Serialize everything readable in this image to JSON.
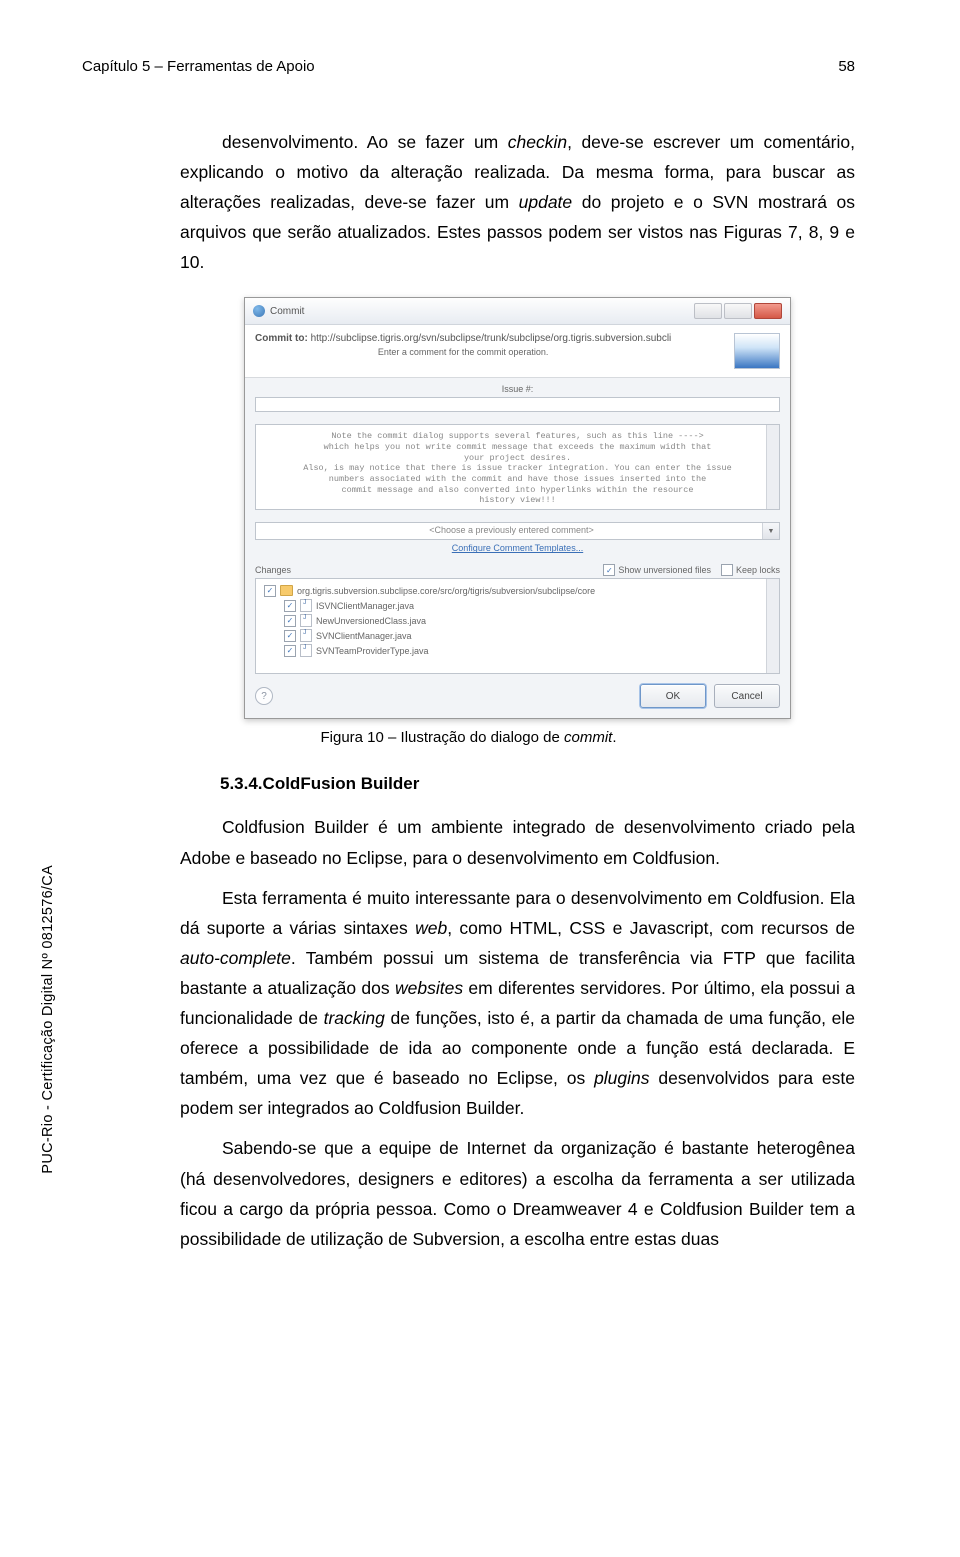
{
  "header": {
    "left": "Capítulo 5 – Ferramentas de Apoio",
    "page_number": "58"
  },
  "sidebar_vertical": "PUC-Rio - Certificação Digital Nº 0812576/CA",
  "para1": {
    "prefix": "desenvolvimento. Ao se fazer um ",
    "italic1": "checkin",
    "mid1": ", deve-se escrever um comentário, explicando o motivo da alteração realizada. Da mesma forma, para buscar as alterações realizadas, deve-se fazer um ",
    "italic2": "update",
    "mid2": " do projeto e o SVN mostrará os arquivos que serão atualizados. Estes passos podem ser vistos nas Figuras 7, 8, 9 e 10."
  },
  "figure_caption": {
    "prefix": "Figura 10 – Ilustração do dialogo de ",
    "italic": "commit",
    "suffix": "."
  },
  "section": {
    "number": "5.3.4.",
    "title": "ColdFusion Builder"
  },
  "para2": "Coldfusion Builder é um ambiente integrado de desenvolvimento criado pela Adobe e baseado no Eclipse, para o desenvolvimento em Coldfusion.",
  "para3": {
    "a": "Esta ferramenta é muito interessante para o desenvolvimento em Coldfusion. Ela dá suporte a várias sintaxes ",
    "i1": "web",
    "b": ", como HTML, CSS e Javascript, com recursos de ",
    "i2": "auto-complete",
    "c": ". Também possui um sistema de transferência via FTP que facilita bastante a atualização dos ",
    "i3": "websites",
    "d": " em diferentes servidores. Por último, ela possui a funcionalidade de ",
    "i4": "tracking",
    "e": " de funções, isto é, a partir da chamada de uma função, ele oferece a possibilidade de ida ao componente onde a função está declarada. E também, uma vez que é baseado no Eclipse, os ",
    "i5": "plugins",
    "f": " desenvolvidos para este podem ser integrados ao Coldfusion Builder."
  },
  "para4": "Sabendo-se que a equipe de Internet da organização é bastante heterogênea (há desenvolvedores, designers e editores) a escolha da ferramenta a ser utilizada ficou a cargo da própria pessoa. Como o Dreamweaver 4 e Coldfusion Builder tem a possibilidade de utilização de Subversion, a escolha entre estas duas",
  "commit_dialog": {
    "title": "Commit",
    "commit_to_label": "Commit to:",
    "commit_to_url": "http://subclipse.tigris.org/svn/subclipse/trunk/subclipse/org.tigris.subversion.subcli",
    "subtitle": "Enter a comment for the commit operation.",
    "issue_label": "Issue #:",
    "issue_value": "",
    "commit_msg_lines": [
      "Note the commit dialog supports several features, such as this line ---->",
      "which helps you not write commit message that exceeds the maximum width that",
      "your project desires.",
      "",
      "Also, is may notice that there is issue tracker integration.  You can enter the issue",
      "numbers associated with the commit and have those issues inserted into the",
      "commit message and also converted into hyperlinks within the resource",
      "history view!!!"
    ],
    "previous_comment_placeholder": "<Choose a previously entered comment>",
    "configure_templates": "Configure Comment Templates...",
    "changes_label": "Changes",
    "show_unversioned_label": "Show unversioned files",
    "keep_locks_label": "Keep locks",
    "show_unversioned_checked": true,
    "keep_locks_checked": false,
    "tree_root": "org.tigris.subversion.subclipse.core/src/org/tigris/subversion/subclipse/core",
    "tree_items": [
      "ISVNClientManager.java",
      "NewUnversionedClass.java",
      "SVNClientManager.java",
      "SVNTeamProviderType.java"
    ],
    "ok": "OK",
    "cancel": "Cancel"
  }
}
